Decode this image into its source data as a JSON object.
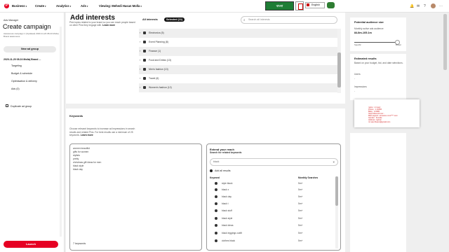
{
  "topbar": {
    "logo": "P",
    "nav": [
      "Business",
      "Create",
      "Analytics",
      "Ads",
      "Viewing: Mehedi Hasan Molla"
    ],
    "bangla_ext": "বাংলা",
    "language": "English"
  },
  "sidebar": {
    "breadcrumb": "Ads Manager",
    "title": "Create campaign",
    "campaign_name": "Awareness campaign 1 (Updated) 2020-11-20 08.24 Molla | Brand awareness",
    "new_ad_group": "New ad group",
    "ad_group_title": "2020-11-20 08.24 Molla| Brand ...",
    "subitems": [
      "Targeting",
      "Budget & schedule",
      "Optimisation & delivery",
      "Ads (0)"
    ],
    "duplicate": "Duplicate ad group",
    "launch": "Launch"
  },
  "interests": {
    "title": "Add interests",
    "desc_pre": "Pick topics related to your brand so you can reach people based on other Pins they engage with.",
    "learn_more": "Learn more",
    "tabs": [
      "All interests",
      "Selected (11)"
    ],
    "search_placeholder": "Search all interests",
    "rows": [
      "Electronics (5)",
      "Event Planning (8)",
      "Finance (1)",
      "Food and Drinks (13)",
      "Men's fashion (13)",
      "Travel (6)",
      "Women's fashion (12)"
    ]
  },
  "keywords": {
    "title": "Keywords",
    "desc": "Choose relevant keywords to increase ad impressions in search results and related Pins. For best results use a minimum of 25 keywords.",
    "learn_more": "Learn more",
    "entered": [
      "women beautiful",
      "gifts for women",
      "stylists",
      "pretty",
      "christmas gift ideas for men",
      "black style",
      "black day"
    ],
    "count": "7 keywords",
    "reach": {
      "title": "Extend your reach",
      "subtitle": "Search for related keywords",
      "search_value": "black",
      "add_all": "Add all results",
      "col_keyword": "Keyword",
      "col_searches": "Monthly Searches",
      "results": [
        {
          "kw": "style black",
          "ms": "5m+"
        },
        {
          "kw": "black x",
          "ms": "5m+"
        },
        {
          "kw": "black day",
          "ms": "5m+"
        },
        {
          "kw": "black t",
          "ms": "5m+"
        },
        {
          "kw": "black stuff",
          "ms": "5m+"
        },
        {
          "kw": "black style",
          "ms": "5m+"
        },
        {
          "kw": "black ideas",
          "ms": "5m+"
        },
        {
          "kw": "black leggings outfit",
          "ms": "5m+"
        },
        {
          "kw": "clothes black",
          "ms": "5m+"
        }
      ]
    }
  },
  "right": {
    "potential_title": "Potential audience size",
    "potential_label": "Monthly active ads audience",
    "potential_value": "84.8m-105.1m",
    "specific": "Specific",
    "broad": "Broad",
    "estimated_title": "Estimated results",
    "estimated_desc": "Based on your budget, bid, and date selections.",
    "users_label": "Users",
    "users_value": "-",
    "impressions_label": "Impressions",
    "impressions_value": "-"
  },
  "popup": {
    "lines": [
      "name : mr.saur",
      "Phone : 1 23456",
      "Bday : 1/1980",
      "https://discord.me/...",
      "Mail  support: someone xxxx****.com",
      "Gender : Female",
      "Address: rayhan",
      "mr.saur.lbeaux@gmail.com"
    ]
  }
}
